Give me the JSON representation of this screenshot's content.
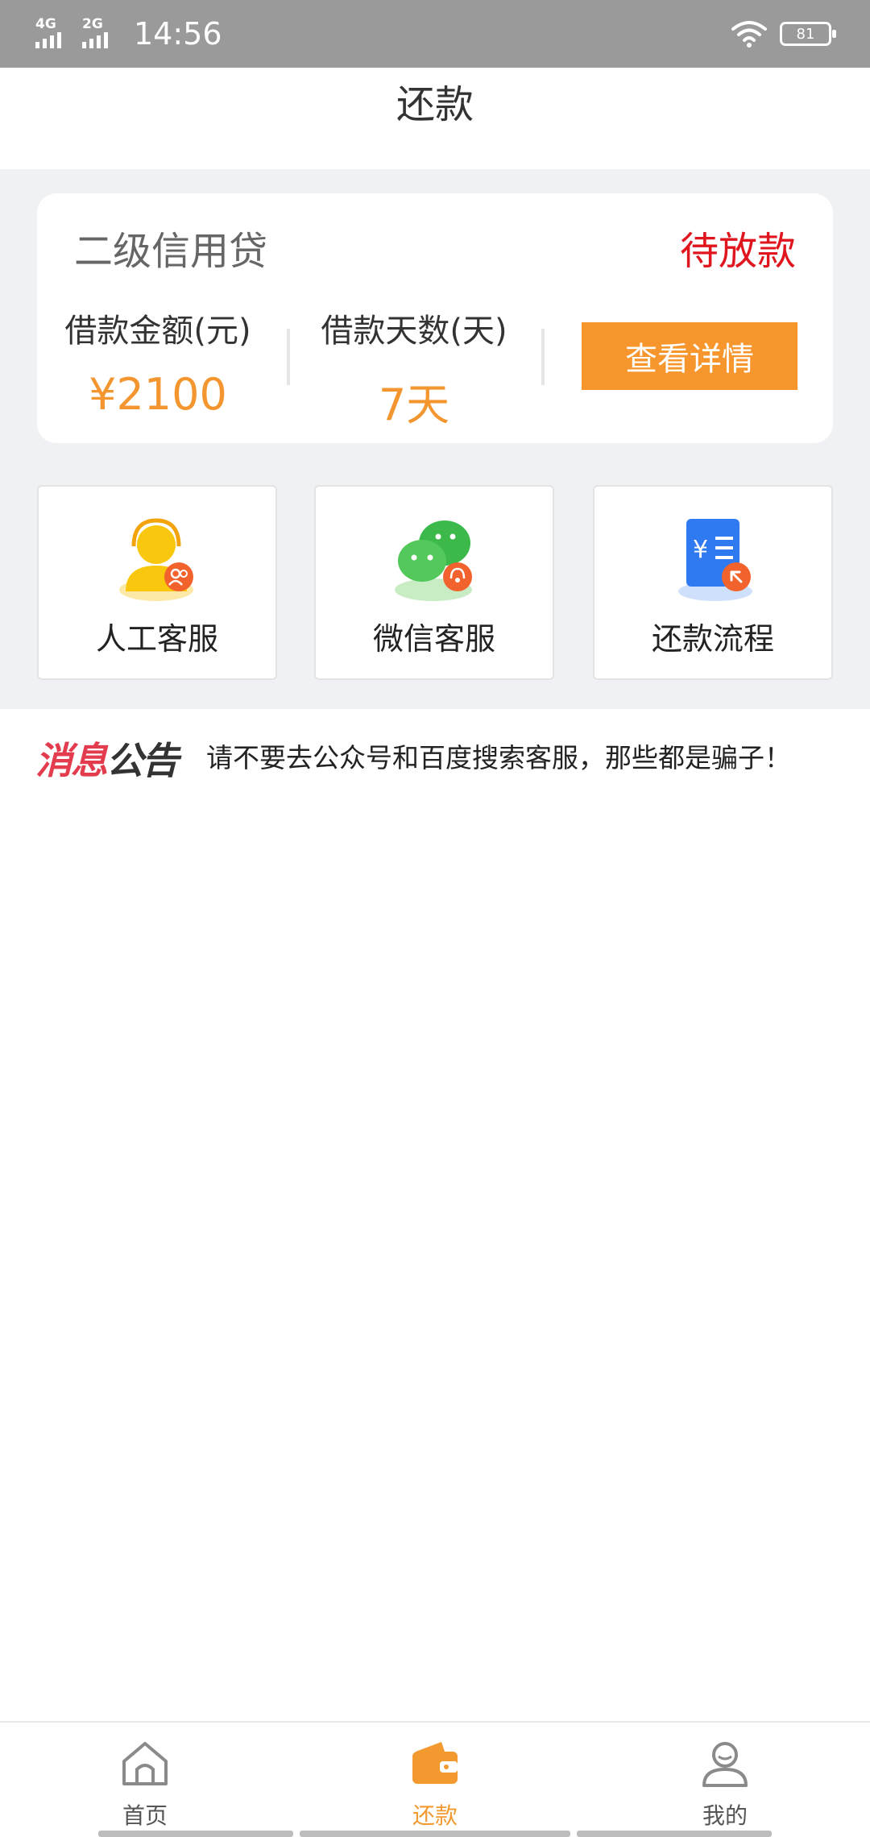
{
  "status_bar": {
    "network1": "4G",
    "network2": "2G",
    "time": "14:56",
    "battery": "81"
  },
  "header": {
    "title": "还款"
  },
  "loan": {
    "name": "二级信用贷",
    "status": "待放款",
    "status_color": "#e0161e",
    "amount_label": "借款金额(元)",
    "amount_value": "¥2100",
    "days_label": "借款天数(天)",
    "days_value": "7天",
    "detail_button": "查看详情"
  },
  "services": [
    {
      "label": "人工客服",
      "icon": "customer-service-icon"
    },
    {
      "label": "微信客服",
      "icon": "wechat-icon"
    },
    {
      "label": "还款流程",
      "icon": "repayment-process-icon"
    }
  ],
  "notice": {
    "logo_part1": "消息",
    "logo_part2": "公告",
    "text": "请不要去公众号和百度搜索客服，那些都是骗子！"
  },
  "bottom_nav": [
    {
      "label": "首页",
      "icon": "home-icon",
      "active": false
    },
    {
      "label": "还款",
      "icon": "wallet-icon",
      "active": true
    },
    {
      "label": "我的",
      "icon": "profile-icon",
      "active": false
    }
  ],
  "colors": {
    "accent": "#f7962d",
    "background": "#eff1f4"
  }
}
